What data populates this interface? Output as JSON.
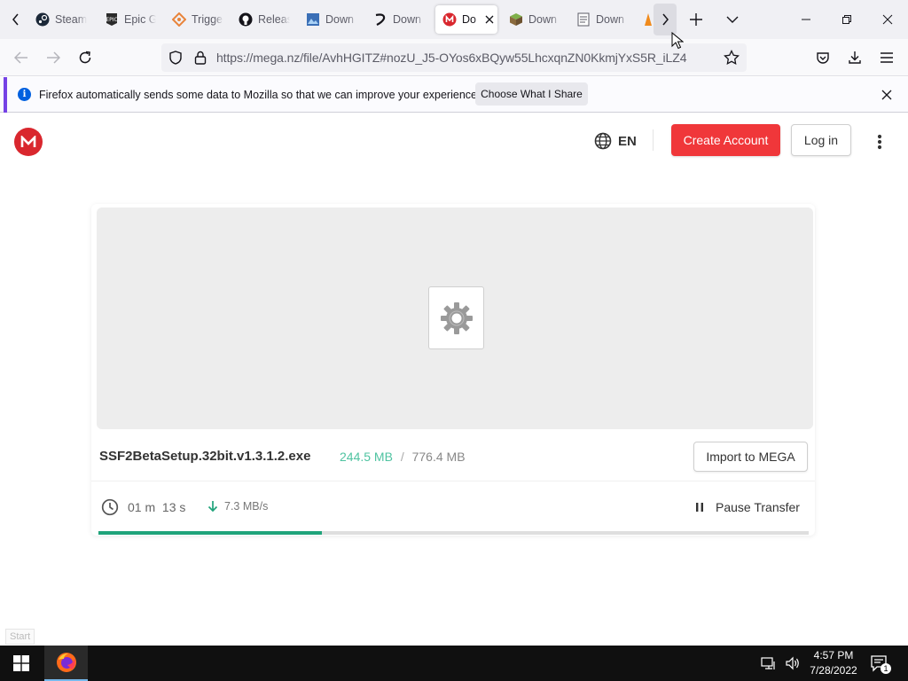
{
  "browser": {
    "tabs": [
      {
        "label": "Steam",
        "icon": "steam-icon"
      },
      {
        "label": "Epic G",
        "icon": "epic-games-icon"
      },
      {
        "label": "Trigge",
        "icon": "trigger-icon"
      },
      {
        "label": "Releas",
        "icon": "github-icon"
      },
      {
        "label": "Down",
        "icon": "image-site-icon"
      },
      {
        "label": "Down",
        "icon": "download-site-icon"
      },
      {
        "label": "Do",
        "icon": "mega-icon",
        "active": true
      },
      {
        "label": "Down",
        "icon": "minecraft-icon"
      },
      {
        "label": "Down",
        "icon": "document-icon"
      }
    ],
    "url": "https://mega.nz/file/AvhHGITZ#nozU_J5-OYos6xBQyw55LhcxqnZN0KkmjYxS5R_iLZ4",
    "notification": {
      "message": "Firefox automatically sends some data to Mozilla so that we can improve your experience.",
      "button": "Choose What I Share"
    }
  },
  "mega": {
    "language": "EN",
    "create_account": "Create Account",
    "log_in": "Log in",
    "file": {
      "name": "SSF2BetaSetup.32bit.v1.3.1.2.exe",
      "downloaded": "244.5 MB",
      "separator": "/",
      "total": "776.4 MB",
      "import_label": "Import to MEGA",
      "time_remaining": "01 m  13 s",
      "speed": "7.3 MB/s",
      "pause_label": "Pause Transfer",
      "progress": 0.315
    }
  },
  "os": {
    "start_tooltip": "Start",
    "time": "4:57 PM",
    "date": "7/28/2022",
    "notification_count": "1"
  },
  "colors": {
    "mega_red": "#d9272e",
    "create_button": "#f0373a",
    "progress_green": "#1fa37a",
    "downloaded_text": "#4fc3a1"
  }
}
